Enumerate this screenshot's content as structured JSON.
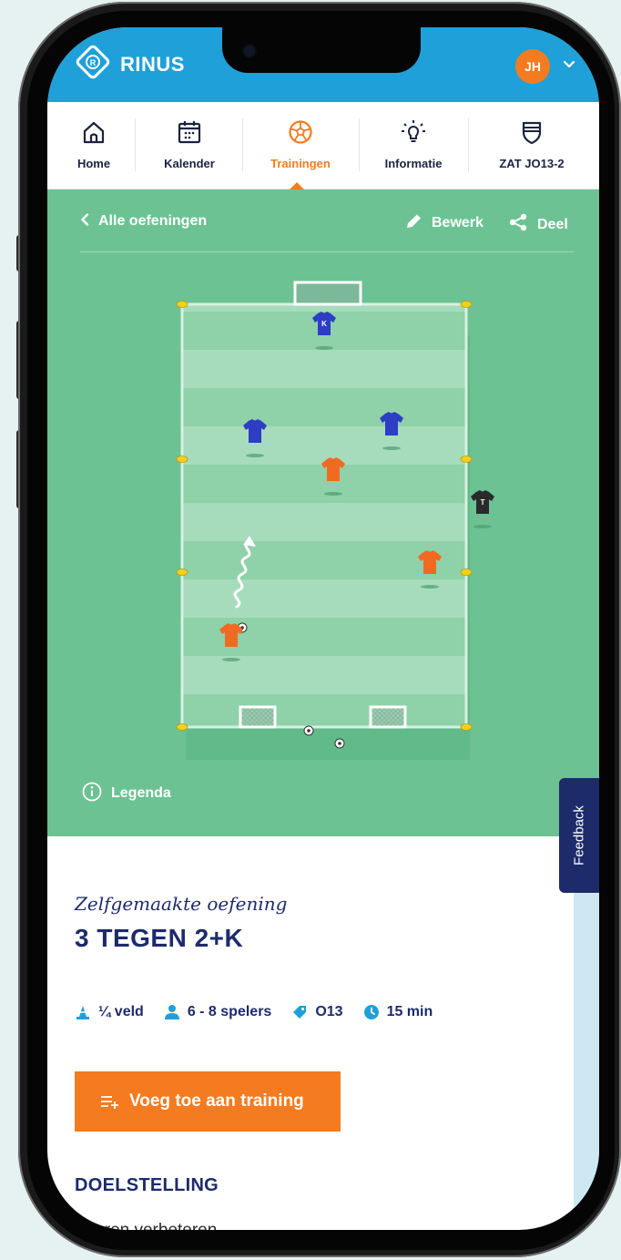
{
  "app": {
    "brand": "RINUS",
    "avatar_initials": "JH",
    "brand_color": "#1fa0d8",
    "accent_color": "#f47b20",
    "navy": "#1d2b6b",
    "field_color": "#6cc293"
  },
  "tabs": [
    {
      "label": "Home",
      "icon": "home-icon"
    },
    {
      "label": "Kalender",
      "icon": "calendar-icon"
    },
    {
      "label": "Trainingen",
      "icon": "football-icon",
      "active": true
    },
    {
      "label": "Informatie",
      "icon": "lightbulb-icon"
    },
    {
      "label": "ZAT JO13-2",
      "icon": "shield-icon"
    }
  ],
  "toolbar": {
    "back_label": "Alle oefeningen",
    "edit_label": "Bewerk",
    "share_label": "Deel"
  },
  "diagram": {
    "keeper_label": "K",
    "neutral_label": "T"
  },
  "legend_label": "Legenda",
  "feedback_label": "Feedback",
  "exercise": {
    "subtitle": "Zelfgemaakte oefening",
    "title": "3 TEGEN 2+K",
    "meta": {
      "field": "¼ veld",
      "players": "6 - 8 spelers",
      "age": "O13",
      "duration": "15 min"
    },
    "cta_label": "Voeg toe aan training",
    "section_heading": "DOELSTELLING",
    "section_text": "Scoren verbeteren"
  }
}
